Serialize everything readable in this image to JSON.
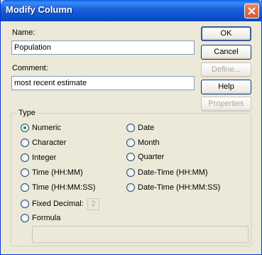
{
  "window": {
    "title": "Modify Column"
  },
  "name_field": {
    "label": "Name:",
    "value": "Population"
  },
  "comment_field": {
    "label": "Comment:",
    "value": "most recent estimate"
  },
  "buttons": {
    "ok": "OK",
    "cancel": "Cancel",
    "define": "Define...",
    "help": "Help",
    "properties": "Properties"
  },
  "type_group": {
    "label": "Type",
    "selected": "Numeric",
    "left_options": [
      "Numeric",
      "Character",
      "Integer",
      "Time (HH:MM)",
      "Time (HH:MM:SS)",
      "Fixed Decimal:",
      "Formula"
    ],
    "right_options": [
      "Date",
      "Month",
      "Quarter",
      "Date-Time (HH:MM)",
      "Date-Time (HH:MM:SS)"
    ],
    "fixed_decimal_value": "2"
  },
  "colors": {
    "titlebar": "#0a5fe8",
    "dialog_bg": "#ece9d8",
    "radio_selected": "#21a121"
  }
}
